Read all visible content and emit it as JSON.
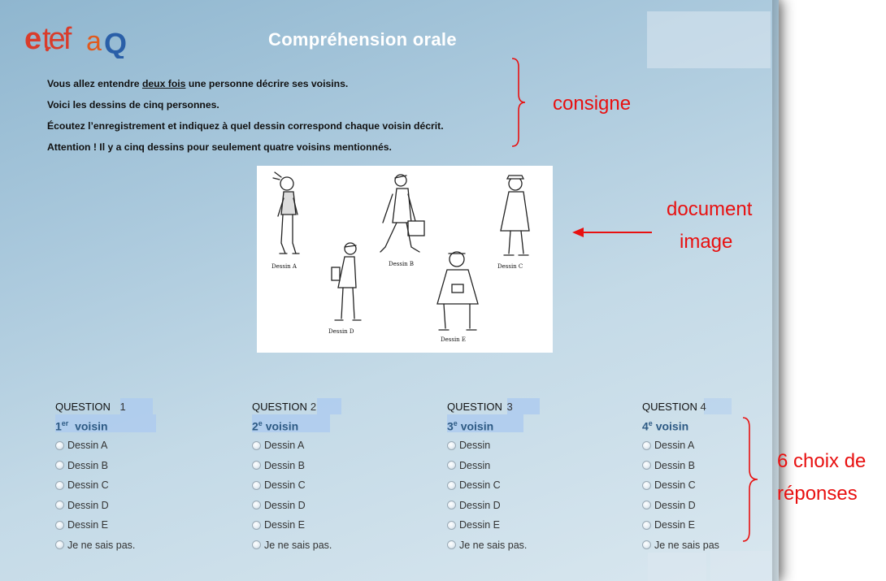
{
  "header": {
    "logo_text": "etefaQ",
    "title": "Compréhension orale"
  },
  "instructions": {
    "line1_pre": "Vous allez entendre ",
    "line1_underline": "deux fois",
    "line1_post": " une personne décrire ses voisins.",
    "line2": "Voici les dessins de cinq personnes.",
    "line3": "Écoutez l’enregistrement et indiquez à quel dessin correspond chaque voisin décrit.",
    "line4": "Attention ! Il y a cinq dessins pour seulement quatre voisins mentionnés."
  },
  "image": {
    "labels": [
      "Dessin A",
      "Dessin B",
      "Dessin C",
      "Dessin D",
      "Dessin E"
    ]
  },
  "questions": [
    {
      "title": "QUESTION",
      "number": "1",
      "sub_num": "1",
      "sub_sup": "er",
      "sub_text": "voisin",
      "options": [
        "Dessin A",
        "Dessin B",
        "Dessin C",
        "Dessin D",
        "Dessin E",
        "Je ne sais pas."
      ]
    },
    {
      "title": "QUESTION",
      "number": "2",
      "sub_num": "2",
      "sub_sup": "e",
      "sub_text": "voisin",
      "options": [
        "Dessin A",
        "Dessin B",
        "Dessin C",
        "Dessin D",
        "Dessin E",
        "Je ne sais pas."
      ]
    },
    {
      "title": "QUESTION",
      "number": "3",
      "sub_num": "3",
      "sub_sup": "e",
      "sub_text": "voisin",
      "options": [
        "Dessin",
        "Dessin",
        "Dessin C",
        "Dessin D",
        "Dessin E",
        "Je ne sais pas."
      ]
    },
    {
      "title": "QUESTION",
      "number": "4",
      "sub_num": "4",
      "sub_sup": "e",
      "sub_text": "voisin",
      "options": [
        "Dessin A",
        "Dessin B",
        "Dessin C",
        "Dessin D",
        "Dessin E",
        "Je ne sais pas"
      ]
    }
  ],
  "annotations": {
    "consigne": "consigne",
    "document": "document",
    "image": "image",
    "choices_line1": "6 choix de",
    "choices_line2": "réponses",
    "color": "#e81010"
  }
}
